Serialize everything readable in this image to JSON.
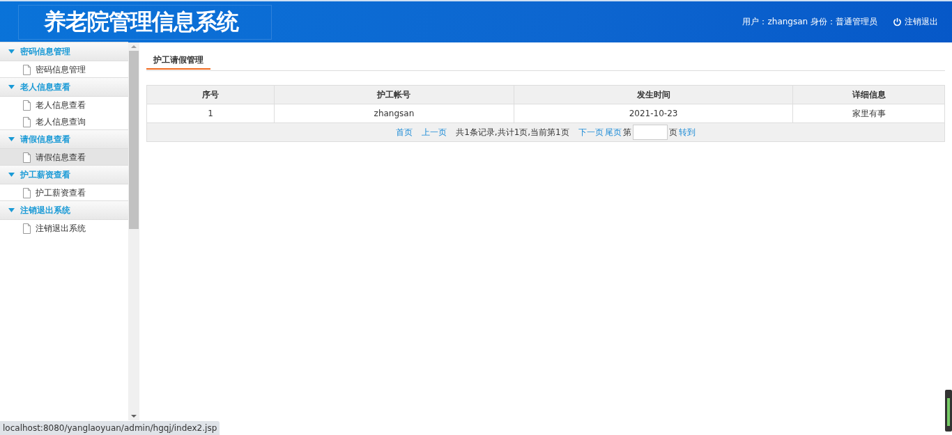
{
  "header": {
    "title": "养老院管理信息系统",
    "user_info": "用户：zhangsan 身份：普通管理员",
    "logout": "注销退出"
  },
  "sidebar": {
    "groups": [
      {
        "label": "密码信息管理",
        "expanded": true,
        "items": [
          {
            "label": "密码信息管理",
            "selected": false
          }
        ]
      },
      {
        "label": "老人信息查看",
        "expanded": true,
        "items": [
          {
            "label": "老人信息查看",
            "selected": false
          },
          {
            "label": "老人信息查询",
            "selected": false
          }
        ]
      },
      {
        "label": "请假信息查看",
        "expanded": true,
        "items": [
          {
            "label": "请假信息查看",
            "selected": true
          }
        ]
      },
      {
        "label": "护工薪资查看",
        "expanded": true,
        "items": [
          {
            "label": "护工薪资查看",
            "selected": false
          }
        ]
      },
      {
        "label": "注销退出系统",
        "expanded": true,
        "items": [
          {
            "label": "注销退出系统",
            "selected": false
          }
        ]
      }
    ]
  },
  "tab": {
    "label": "护工请假管理"
  },
  "table": {
    "columns": [
      "序号",
      "护工帐号",
      "发生时间",
      "详细信息"
    ],
    "rows": [
      [
        "1",
        "zhangsan",
        "2021-10-23",
        "家里有事"
      ]
    ]
  },
  "pagination": {
    "first": "首页",
    "prev": "上一页",
    "summary": "共1条记录,共计1页,当前第1页",
    "next": "下一页",
    "last": "尾页",
    "page_prefix": "第",
    "page_suffix": "页",
    "go": "转到"
  },
  "status_bar": {
    "url": "localhost:8080/yanglaoyuan/admin/hgqj/index2.jsp"
  }
}
